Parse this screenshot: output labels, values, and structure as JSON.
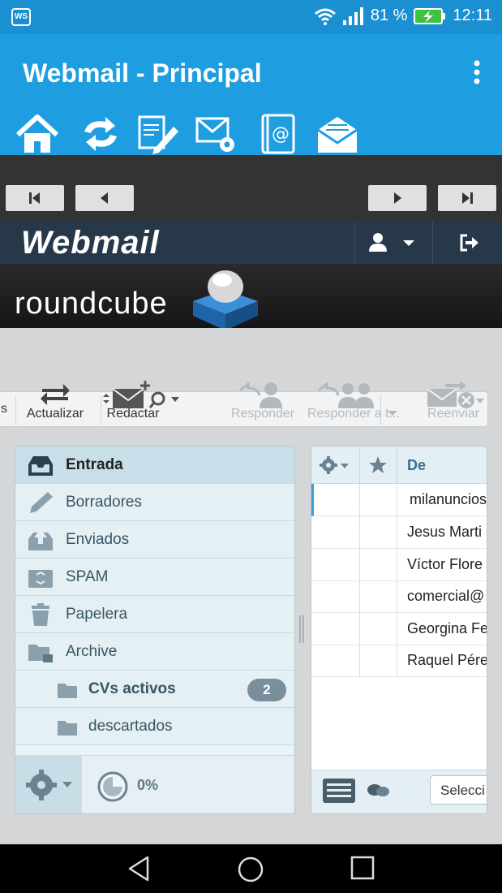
{
  "status_bar": {
    "app_badge": "WS",
    "battery_percent": "81 %",
    "time": "12:11"
  },
  "app_bar": {
    "title": "Webmail - Principal"
  },
  "webmail": {
    "logo_text": "Webmail",
    "brand_text": "roundcube"
  },
  "toolbar": {
    "partial_left": "s",
    "refresh": "Actualizar",
    "compose": "Redactar",
    "reply": "Responder",
    "reply_all": "Responder a t...",
    "forward": "Reenviar"
  },
  "folders": [
    {
      "name": "Entrada"
    },
    {
      "name": "Borradores"
    },
    {
      "name": "Enviados"
    },
    {
      "name": "SPAM"
    },
    {
      "name": "Papelera"
    },
    {
      "name": "Archive"
    },
    {
      "name": "CVs activos",
      "count": "2"
    },
    {
      "name": "descartados"
    }
  ],
  "quota": "0%",
  "message_list": {
    "column_from": "De",
    "rows": [
      {
        "from": "milanuncios"
      },
      {
        "from": "Jesus Marti"
      },
      {
        "from": "Víctor Flore"
      },
      {
        "from": "comercial@"
      },
      {
        "from": "Georgina Fe"
      },
      {
        "from": "Raquel Pére"
      }
    ],
    "select_button": "Selecci"
  },
  "colors": {
    "accent": "#1e9ee0",
    "header_dark": "#27384a",
    "folder_selected": "#c8dfea"
  }
}
